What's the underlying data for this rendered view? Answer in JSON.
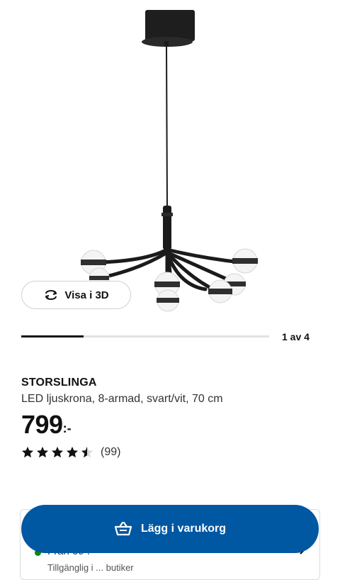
{
  "gallery": {
    "view_3d_label": "Visa i 3D",
    "counter": "1 av 4",
    "progress": 0.25
  },
  "product": {
    "name": "STORSLINGA",
    "description": "LED ljuskrona, 8-armad, svart/vit, 70 cm",
    "price": "799",
    "price_suffix": ":-",
    "rating": 4.5,
    "review_count": "(99)"
  },
  "availability": {
    "label": "Från 09 :",
    "sub": "Tillgänglig i ... butiker"
  },
  "cart": {
    "add_label": "Lägg i varukorg"
  },
  "colors": {
    "brand": "#0058a3",
    "stock": "#0a8a00"
  }
}
